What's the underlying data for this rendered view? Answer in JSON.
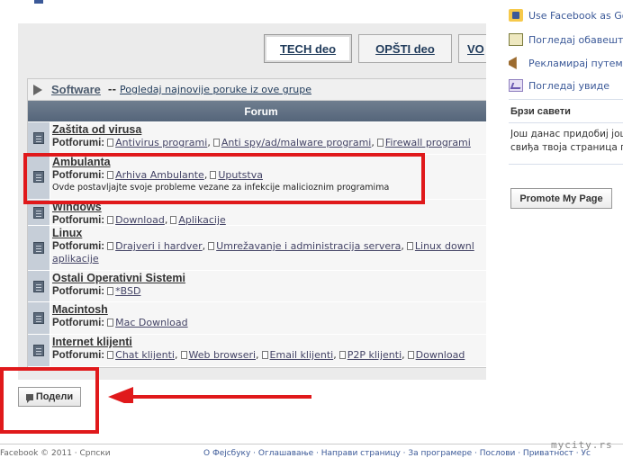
{
  "tabs": [
    {
      "label": "TECH deo",
      "active": true
    },
    {
      "label": "OPŠTI deo",
      "active": false
    },
    {
      "label": "VO",
      "active": false
    }
  ],
  "group": {
    "title": "Software",
    "separator": "--",
    "link": "Pogledaj najnovije poruke iz ove grupe",
    "icon": "arrow-right-icon"
  },
  "forum_header": "Forum",
  "subforum_label": "Potforumi:",
  "forums": [
    {
      "title": "Zaštita od virusa",
      "subforums": [
        "Antivirus programi",
        "Anti spy/ad/malware programi",
        "Firewall programi"
      ],
      "description": ""
    },
    {
      "title": "Ambulanta",
      "subforums": [
        "Arhiva Ambulante",
        "Uputstva"
      ],
      "description": "Ovde postavljajte svoje probleme vezane za infekcije malicioznim programima"
    },
    {
      "title": "Windows",
      "subforums": [
        "Download",
        "Aplikacije"
      ],
      "description": ""
    },
    {
      "title": "Linux",
      "subforums": [
        "Drajveri i hardver",
        "Umrežavanje i administracija servera",
        "Linux downl"
      ],
      "description": "aplikacije"
    },
    {
      "title": "Ostali Operativni Sistemi",
      "subforums": [
        "*BSD"
      ],
      "description": ""
    },
    {
      "title": "Macintosh",
      "subforums": [
        "Mac Download"
      ],
      "description": ""
    },
    {
      "title": "Internet klijenti",
      "subforums": [
        "Chat klijenti",
        "Web browseri",
        "Email klijenti",
        "P2P klijenti",
        "Download"
      ],
      "description": ""
    }
  ],
  "share_button": {
    "label": "Подели",
    "icon": "speech-bubble-icon"
  },
  "sidebar": {
    "links": [
      {
        "label": "Use Facebook as Gora",
        "icon": "facebook-page-icon"
      },
      {
        "label": "Погледај обавештењ",
        "icon": "notice-board-icon"
      },
      {
        "label": "Рекламирај путем ог",
        "icon": "megaphone-icon"
      },
      {
        "label": "Погледај увиде",
        "icon": "insights-chart-icon"
      }
    ],
    "tips_title": "Брзи савети",
    "tips_text": [
      "Још данас придобиј још с",
      "свиђа твоја страница пр"
    ],
    "promote_button": "Promote My Page"
  },
  "footer": {
    "left": "Facebook © 2011 · Српски",
    "right": "О Фејсбуку · Оглашавање · Направи страницу · За програмере · Послови · Приватност · Ус"
  },
  "watermark": "mycity.rs",
  "colors": {
    "annotation_red": "#e0191b",
    "forum_header": "#5f6f83",
    "link_blue": "#3b5998"
  }
}
